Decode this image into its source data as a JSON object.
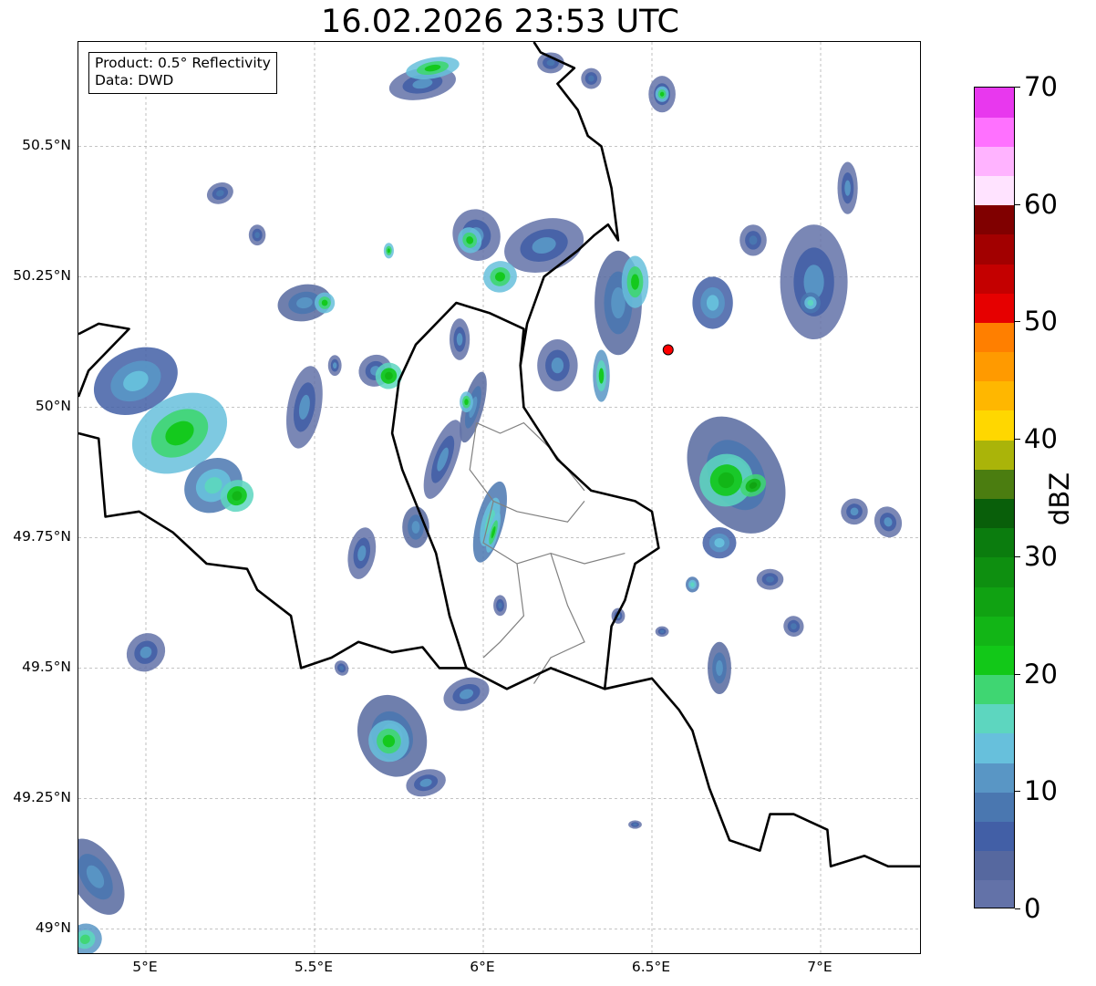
{
  "title": "16.02.2026 23:53 UTC",
  "info_box": {
    "product": "Product: 0.5° Reflectivity",
    "data_source": "Data: DWD"
  },
  "map_extent": {
    "lon_min": 4.8,
    "lon_max": 7.3,
    "lat_min": 48.95,
    "lat_max": 50.7
  },
  "lat_ticks": [
    {
      "value": 50.5,
      "label": "50.5°N"
    },
    {
      "value": 50.25,
      "label": "50.25°N"
    },
    {
      "value": 50.0,
      "label": "50°N"
    },
    {
      "value": 49.75,
      "label": "49.75°N"
    },
    {
      "value": 49.5,
      "label": "49.5°N"
    },
    {
      "value": 49.25,
      "label": "49.25°N"
    },
    {
      "value": 49.0,
      "label": "49°N"
    }
  ],
  "lon_ticks": [
    {
      "value": 5.0,
      "label": "5°E"
    },
    {
      "value": 5.5,
      "label": "5.5°E"
    },
    {
      "value": 6.0,
      "label": "6°E"
    },
    {
      "value": 6.5,
      "label": "6.5°E"
    },
    {
      "value": 7.0,
      "label": "7°E"
    }
  ],
  "radar_site": {
    "lon": 6.548,
    "lat": 50.11,
    "color": "#ff0000"
  },
  "colorbar": {
    "unit": "dBZ",
    "min": 0,
    "max": 70,
    "ticks": [
      0,
      10,
      20,
      30,
      40,
      50,
      60,
      70
    ],
    "colors": [
      "#6372a8",
      "#56689f",
      "#425fa6",
      "#4a77b0",
      "#5996c5",
      "#67c0dc",
      "#5dd6bf",
      "#3fd672",
      "#12c818",
      "#12b516",
      "#10a212",
      "#0e8f10",
      "#0b7c0e",
      "#095f0a",
      "#4b7d10",
      "#aab409",
      "#ffd700",
      "#ffb700",
      "#ff9a00",
      "#ff7f00",
      "#e60000",
      "#c40000",
      "#a20000",
      "#800000",
      "#ffe3ff",
      "#ffb3ff",
      "#ff71ff",
      "#e838ee"
    ]
  },
  "echoes": [
    {
      "lon": 4.97,
      "lat": 50.05,
      "rx": 0.13,
      "ry": 0.06,
      "rot": -25,
      "dbz": 14
    },
    {
      "lon": 5.1,
      "lat": 49.95,
      "rx": 0.15,
      "ry": 0.07,
      "rot": -30,
      "dbz": 22
    },
    {
      "lon": 5.2,
      "lat": 49.85,
      "rx": 0.09,
      "ry": 0.05,
      "rot": -35,
      "dbz": 16
    },
    {
      "lon": 5.27,
      "lat": 49.83,
      "rx": 0.05,
      "ry": 0.03,
      "rot": -30,
      "dbz": 23
    },
    {
      "lon": 5.0,
      "lat": 49.53,
      "rx": 0.06,
      "ry": 0.035,
      "rot": -45,
      "dbz": 10
    },
    {
      "lon": 5.22,
      "lat": 50.41,
      "rx": 0.04,
      "ry": 0.02,
      "rot": -20,
      "dbz": 8
    },
    {
      "lon": 5.33,
      "lat": 50.33,
      "rx": 0.025,
      "ry": 0.02,
      "rot": 0,
      "dbz": 8
    },
    {
      "lon": 5.47,
      "lat": 50.2,
      "rx": 0.08,
      "ry": 0.035,
      "rot": -10,
      "dbz": 12
    },
    {
      "lon": 5.53,
      "lat": 50.2,
      "rx": 0.03,
      "ry": 0.02,
      "rot": -10,
      "dbz": 22
    },
    {
      "lon": 5.47,
      "lat": 50.0,
      "rx": 0.05,
      "ry": 0.08,
      "rot": 10,
      "dbz": 10
    },
    {
      "lon": 5.68,
      "lat": 50.07,
      "rx": 0.05,
      "ry": 0.03,
      "rot": -30,
      "dbz": 10
    },
    {
      "lon": 5.72,
      "lat": 50.06,
      "rx": 0.04,
      "ry": 0.025,
      "rot": -30,
      "dbz": 24
    },
    {
      "lon": 5.82,
      "lat": 50.62,
      "rx": 0.1,
      "ry": 0.03,
      "rot": -10,
      "dbz": 10
    },
    {
      "lon": 5.85,
      "lat": 50.65,
      "rx": 0.08,
      "ry": 0.02,
      "rot": -10,
      "dbz": 22
    },
    {
      "lon": 5.98,
      "lat": 50.33,
      "rx": 0.07,
      "ry": 0.05,
      "rot": -20,
      "dbz": 10
    },
    {
      "lon": 5.96,
      "lat": 50.32,
      "rx": 0.035,
      "ry": 0.025,
      "rot": -20,
      "dbz": 22
    },
    {
      "lon": 5.72,
      "lat": 50.3,
      "rx": 0.015,
      "ry": 0.015,
      "rot": 0,
      "dbz": 22
    },
    {
      "lon": 5.93,
      "lat": 50.13,
      "rx": 0.03,
      "ry": 0.04,
      "rot": 0,
      "dbz": 10
    },
    {
      "lon": 5.97,
      "lat": 50.0,
      "rx": 0.03,
      "ry": 0.07,
      "rot": 15,
      "dbz": 12
    },
    {
      "lon": 5.88,
      "lat": 49.9,
      "rx": 0.04,
      "ry": 0.08,
      "rot": 20,
      "dbz": 10
    },
    {
      "lon": 6.02,
      "lat": 49.78,
      "rx": 0.04,
      "ry": 0.08,
      "rot": 15,
      "dbz": 16
    },
    {
      "lon": 6.03,
      "lat": 49.76,
      "rx": 0.015,
      "ry": 0.04,
      "rot": 15,
      "dbz": 22
    },
    {
      "lon": 5.8,
      "lat": 49.77,
      "rx": 0.04,
      "ry": 0.04,
      "rot": 0,
      "dbz": 12
    },
    {
      "lon": 5.64,
      "lat": 49.72,
      "rx": 0.04,
      "ry": 0.05,
      "rot": 10,
      "dbz": 10
    },
    {
      "lon": 5.73,
      "lat": 49.37,
      "rx": 0.1,
      "ry": 0.08,
      "rot": -20,
      "dbz": 12
    },
    {
      "lon": 5.72,
      "lat": 49.36,
      "rx": 0.06,
      "ry": 0.04,
      "rot": -20,
      "dbz": 22
    },
    {
      "lon": 5.83,
      "lat": 49.28,
      "rx": 0.06,
      "ry": 0.025,
      "rot": -15,
      "dbz": 10
    },
    {
      "lon": 5.95,
      "lat": 49.45,
      "rx": 0.07,
      "ry": 0.03,
      "rot": -20,
      "dbz": 10
    },
    {
      "lon": 6.18,
      "lat": 50.31,
      "rx": 0.12,
      "ry": 0.05,
      "rot": -15,
      "dbz": 10
    },
    {
      "lon": 6.05,
      "lat": 50.25,
      "rx": 0.05,
      "ry": 0.03,
      "rot": -15,
      "dbz": 22
    },
    {
      "lon": 6.22,
      "lat": 50.08,
      "rx": 0.06,
      "ry": 0.05,
      "rot": 0,
      "dbz": 10
    },
    {
      "lon": 6.4,
      "lat": 50.2,
      "rx": 0.07,
      "ry": 0.1,
      "rot": 0,
      "dbz": 12
    },
    {
      "lon": 6.45,
      "lat": 50.24,
      "rx": 0.04,
      "ry": 0.05,
      "rot": 0,
      "dbz": 22
    },
    {
      "lon": 6.35,
      "lat": 50.06,
      "rx": 0.025,
      "ry": 0.05,
      "rot": 0,
      "dbz": 20
    },
    {
      "lon": 6.53,
      "lat": 50.6,
      "rx": 0.04,
      "ry": 0.035,
      "rot": 0,
      "dbz": 10
    },
    {
      "lon": 6.53,
      "lat": 50.6,
      "rx": 0.02,
      "ry": 0.015,
      "rot": 0,
      "dbz": 22
    },
    {
      "lon": 6.32,
      "lat": 50.63,
      "rx": 0.03,
      "ry": 0.02,
      "rot": 0,
      "dbz": 8
    },
    {
      "lon": 6.2,
      "lat": 50.66,
      "rx": 0.04,
      "ry": 0.02,
      "rot": 0,
      "dbz": 8
    },
    {
      "lon": 5.95,
      "lat": 50.01,
      "rx": 0.02,
      "ry": 0.02,
      "rot": 0,
      "dbz": 22
    },
    {
      "lon": 6.68,
      "lat": 50.2,
      "rx": 0.06,
      "ry": 0.05,
      "rot": 0,
      "dbz": 14
    },
    {
      "lon": 6.98,
      "lat": 50.24,
      "rx": 0.1,
      "ry": 0.11,
      "rot": 0,
      "dbz": 10
    },
    {
      "lon": 6.97,
      "lat": 50.2,
      "rx": 0.03,
      "ry": 0.02,
      "rot": 0,
      "dbz": 16
    },
    {
      "lon": 7.08,
      "lat": 50.42,
      "rx": 0.03,
      "ry": 0.05,
      "rot": 0,
      "dbz": 10
    },
    {
      "lon": 6.8,
      "lat": 50.32,
      "rx": 0.04,
      "ry": 0.03,
      "rot": 0,
      "dbz": 8
    },
    {
      "lon": 6.75,
      "lat": 49.87,
      "rx": 0.13,
      "ry": 0.12,
      "rot": -30,
      "dbz": 12
    },
    {
      "lon": 6.72,
      "lat": 49.86,
      "rx": 0.08,
      "ry": 0.05,
      "rot": -30,
      "dbz": 23
    },
    {
      "lon": 6.8,
      "lat": 49.85,
      "rx": 0.04,
      "ry": 0.02,
      "rot": -30,
      "dbz": 27
    },
    {
      "lon": 6.7,
      "lat": 49.74,
      "rx": 0.05,
      "ry": 0.03,
      "rot": 0,
      "dbz": 14
    },
    {
      "lon": 7.1,
      "lat": 49.8,
      "rx": 0.04,
      "ry": 0.025,
      "rot": -20,
      "dbz": 10
    },
    {
      "lon": 7.2,
      "lat": 49.78,
      "rx": 0.04,
      "ry": 0.03,
      "rot": -20,
      "dbz": 10
    },
    {
      "lon": 6.85,
      "lat": 49.67,
      "rx": 0.04,
      "ry": 0.02,
      "rot": 0,
      "dbz": 8
    },
    {
      "lon": 6.92,
      "lat": 49.58,
      "rx": 0.03,
      "ry": 0.02,
      "rot": -20,
      "dbz": 8
    },
    {
      "lon": 6.62,
      "lat": 49.66,
      "rx": 0.02,
      "ry": 0.015,
      "rot": 0,
      "dbz": 16
    },
    {
      "lon": 6.7,
      "lat": 49.5,
      "rx": 0.035,
      "ry": 0.05,
      "rot": 0,
      "dbz": 12
    },
    {
      "lon": 6.4,
      "lat": 49.6,
      "rx": 0.02,
      "ry": 0.015,
      "rot": 0,
      "dbz": 10
    },
    {
      "lon": 6.53,
      "lat": 49.57,
      "rx": 0.02,
      "ry": 0.01,
      "rot": 0,
      "dbz": 8
    },
    {
      "lon": 6.45,
      "lat": 49.2,
      "rx": 0.02,
      "ry": 0.008,
      "rot": 0,
      "dbz": 8
    },
    {
      "lon": 4.85,
      "lat": 49.1,
      "rx": 0.07,
      "ry": 0.08,
      "rot": -30,
      "dbz": 12
    },
    {
      "lon": 4.82,
      "lat": 48.98,
      "rx": 0.05,
      "ry": 0.03,
      "rot": -20,
      "dbz": 18
    },
    {
      "lon": 5.58,
      "lat": 49.5,
      "rx": 0.02,
      "ry": 0.015,
      "rot": -30,
      "dbz": 8
    },
    {
      "lon": 6.05,
      "lat": 49.62,
      "rx": 0.02,
      "ry": 0.02,
      "rot": 0,
      "dbz": 8
    },
    {
      "lon": 5.56,
      "lat": 50.08,
      "rx": 0.02,
      "ry": 0.02,
      "rot": 0,
      "dbz": 10
    }
  ],
  "borders": {
    "national": [
      [
        [
          4.8,
          50.02
        ],
        [
          4.83,
          50.07
        ],
        [
          4.95,
          50.15
        ],
        [
          4.86,
          50.16
        ],
        [
          4.8,
          50.14
        ]
      ],
      [
        [
          4.8,
          49.95
        ],
        [
          4.86,
          49.94
        ],
        [
          4.88,
          49.79
        ],
        [
          4.98,
          49.8
        ],
        [
          5.08,
          49.76
        ],
        [
          5.18,
          49.7
        ],
        [
          5.3,
          49.69
        ],
        [
          5.33,
          49.65
        ],
        [
          5.43,
          49.6
        ],
        [
          5.46,
          49.5
        ],
        [
          5.55,
          49.52
        ],
        [
          5.63,
          49.55
        ],
        [
          5.73,
          49.53
        ],
        [
          5.82,
          49.54
        ],
        [
          5.87,
          49.5
        ],
        [
          5.95,
          49.5
        ],
        [
          6.07,
          49.46
        ],
        [
          6.2,
          49.5
        ],
        [
          6.28,
          49.48
        ],
        [
          6.36,
          49.46
        ],
        [
          6.5,
          49.48
        ],
        [
          6.58,
          49.42
        ],
        [
          6.62,
          49.38
        ],
        [
          6.67,
          49.27
        ],
        [
          6.73,
          49.17
        ],
        [
          6.82,
          49.15
        ],
        [
          6.85,
          49.22
        ],
        [
          6.92,
          49.22
        ],
        [
          7.02,
          49.19
        ],
        [
          7.03,
          49.12
        ],
        [
          7.13,
          49.14
        ],
        [
          7.2,
          49.12
        ],
        [
          7.3,
          49.12
        ]
      ],
      [
        [
          5.95,
          49.5
        ],
        [
          5.9,
          49.6
        ],
        [
          5.86,
          49.72
        ],
        [
          5.81,
          49.8
        ],
        [
          5.76,
          49.88
        ],
        [
          5.73,
          49.95
        ],
        [
          5.75,
          50.05
        ],
        [
          5.8,
          50.12
        ],
        [
          5.92,
          50.2
        ],
        [
          6.02,
          50.18
        ],
        [
          6.12,
          50.15
        ],
        [
          6.11,
          50.08
        ],
        [
          6.12,
          50.0
        ],
        [
          6.22,
          49.9
        ],
        [
          6.32,
          49.84
        ],
        [
          6.45,
          49.82
        ],
        [
          6.5,
          49.8
        ],
        [
          6.52,
          49.73
        ],
        [
          6.45,
          49.7
        ],
        [
          6.42,
          49.63
        ],
        [
          6.38,
          49.58
        ],
        [
          6.36,
          49.46
        ]
      ],
      [
        [
          6.11,
          50.08
        ],
        [
          6.13,
          50.16
        ],
        [
          6.18,
          50.25
        ],
        [
          6.28,
          50.3
        ],
        [
          6.33,
          50.33
        ],
        [
          6.37,
          50.35
        ],
        [
          6.4,
          50.32
        ],
        [
          6.38,
          50.42
        ],
        [
          6.35,
          50.5
        ],
        [
          6.31,
          50.52
        ],
        [
          6.28,
          50.57
        ],
        [
          6.22,
          50.62
        ],
        [
          6.27,
          50.65
        ],
        [
          6.17,
          50.68
        ],
        [
          6.15,
          50.7
        ]
      ]
    ],
    "regional": [
      [
        [
          5.98,
          49.97
        ],
        [
          6.05,
          49.95
        ],
        [
          6.12,
          49.97
        ],
        [
          6.2,
          49.92
        ],
        [
          6.25,
          49.88
        ],
        [
          6.3,
          49.84
        ]
      ],
      [
        [
          5.98,
          49.97
        ],
        [
          5.96,
          49.88
        ],
        [
          6.03,
          49.82
        ],
        [
          6.1,
          49.8
        ],
        [
          6.25,
          49.78
        ],
        [
          6.3,
          49.82
        ]
      ],
      [
        [
          6.03,
          49.82
        ],
        [
          6.0,
          49.74
        ],
        [
          6.1,
          49.7
        ],
        [
          6.2,
          49.72
        ],
        [
          6.3,
          49.7
        ],
        [
          6.42,
          49.72
        ]
      ],
      [
        [
          6.1,
          49.7
        ],
        [
          6.12,
          49.6
        ],
        [
          6.05,
          49.55
        ],
        [
          6.0,
          49.52
        ]
      ],
      [
        [
          6.2,
          49.72
        ],
        [
          6.25,
          49.62
        ],
        [
          6.3,
          49.55
        ],
        [
          6.2,
          49.52
        ],
        [
          6.15,
          49.47
        ]
      ]
    ]
  }
}
